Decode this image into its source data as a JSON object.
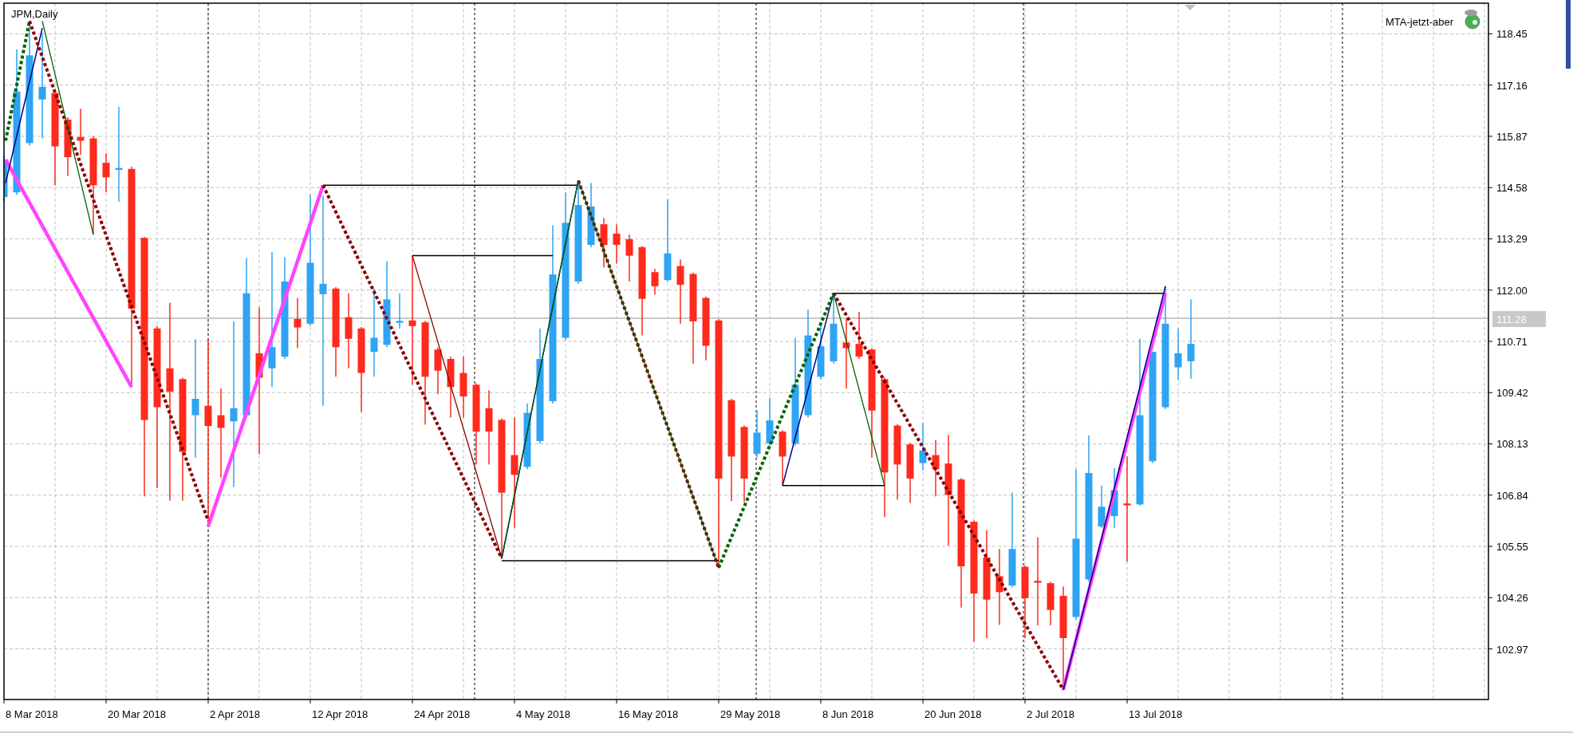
{
  "chart": {
    "title": "JPM,Daily",
    "indicator": "MTA-jetzt-aber",
    "current_price": "111.28",
    "y_axis_labels": [
      "118.45",
      "117.16",
      "115.87",
      "114.58",
      "113.29",
      "112.00",
      "110.71",
      "109.42",
      "108.13",
      "106.84",
      "105.55",
      "104.26",
      "102.97"
    ],
    "x_axis_labels": [
      "8 Mar 2018",
      "20 Mar 2018",
      "2 Apr 2018",
      "12 Apr 2018",
      "24 Apr 2018",
      "4 May 2018",
      "16 May 2018",
      "29 May 2018",
      "8 Jun 2018",
      "20 Jun 2018",
      "2 Jul 2018",
      "13 Jul 2018"
    ]
  }
}
